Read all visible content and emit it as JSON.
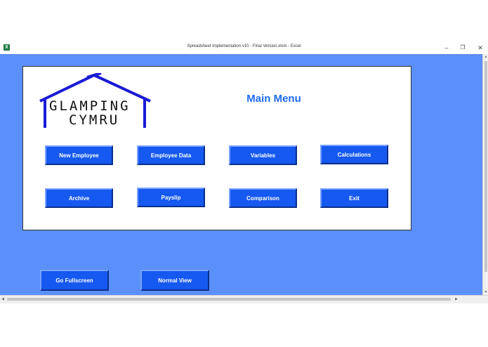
{
  "window": {
    "title": "Spreadsheet Implementation v10 - Final Version.xlsm - Excel",
    "app_icon_letter": "X",
    "minimize_glyph": "–",
    "restore_glyph": "❐",
    "close_glyph": "✕"
  },
  "logo": {
    "line1": "GLAMPING",
    "line2": "CYMRU",
    "color": "#1a1ad6"
  },
  "menu": {
    "title": "Main Menu",
    "buttons": [
      "New Employee",
      "Employee Data",
      "Variables",
      "Calculations",
      "Archive",
      "Payslip",
      "Comparison",
      "Exit"
    ]
  },
  "view_buttons": {
    "fullscreen": "Go Fullscreen",
    "normal": "Normal View"
  },
  "colors": {
    "workspace": "#5b8ff9",
    "button": "#1659f0",
    "title": "#1f6cf0"
  }
}
